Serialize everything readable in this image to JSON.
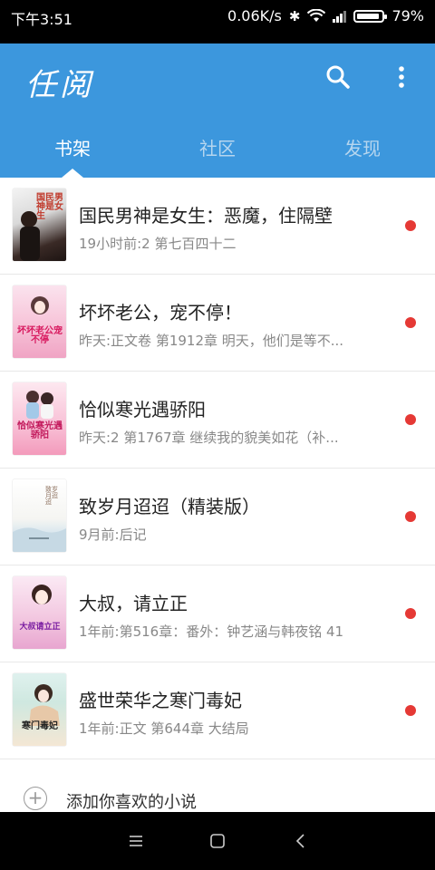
{
  "status_bar": {
    "time": "下午3:51",
    "network_speed": "0.06K/s",
    "battery": "79%",
    "icons": [
      "bluetooth-icon",
      "wifi-icon",
      "signal-icon",
      "battery-icon"
    ]
  },
  "header": {
    "app_name": "任阅",
    "icons": [
      "search-icon",
      "more-icon"
    ],
    "tabs": [
      {
        "label": "书架",
        "active": true
      },
      {
        "label": "社区",
        "active": false
      },
      {
        "label": "发现",
        "active": false
      }
    ],
    "accent": "#3c97dd"
  },
  "books": [
    {
      "title": "国民男神是女生：恶魔，住隔壁",
      "subtitle": "19小时前:2 第七百四十二",
      "cover_text": "国民男神是女生",
      "unread": true
    },
    {
      "title": "坏坏老公，宠不停！",
      "subtitle": "昨天:正文卷 第1912章 明天，他们是等不...",
      "cover_text": "坏坏老公宠不停",
      "unread": true
    },
    {
      "title": "恰似寒光遇骄阳",
      "subtitle": "昨天:2 第1767章 继续我的貌美如花（补...",
      "cover_text": "恰似寒光遇骄阳",
      "unread": true
    },
    {
      "title": "致岁月迢迢（精装版）",
      "subtitle": "9月前:后记",
      "cover_text": "致岁月迢迢",
      "unread": true
    },
    {
      "title": "大叔，请立正",
      "subtitle": "1年前:第516章：番外：钟艺涵与韩夜铭 41",
      "cover_text": "大叔请立正",
      "unread": true
    },
    {
      "title": "盛世荣华之寒门毒妃",
      "subtitle": "1年前:正文 第644章 大结局",
      "cover_text": "寒门毒妃",
      "unread": true
    }
  ],
  "add_book": {
    "label": "添加你喜欢的小说",
    "icon": "plus-circle-icon"
  },
  "nav_bar": {
    "icons": [
      "menu-icon",
      "home-icon",
      "back-icon"
    ]
  },
  "colors": {
    "unread_dot": "#e53935",
    "divider": "#e8e8e8"
  }
}
